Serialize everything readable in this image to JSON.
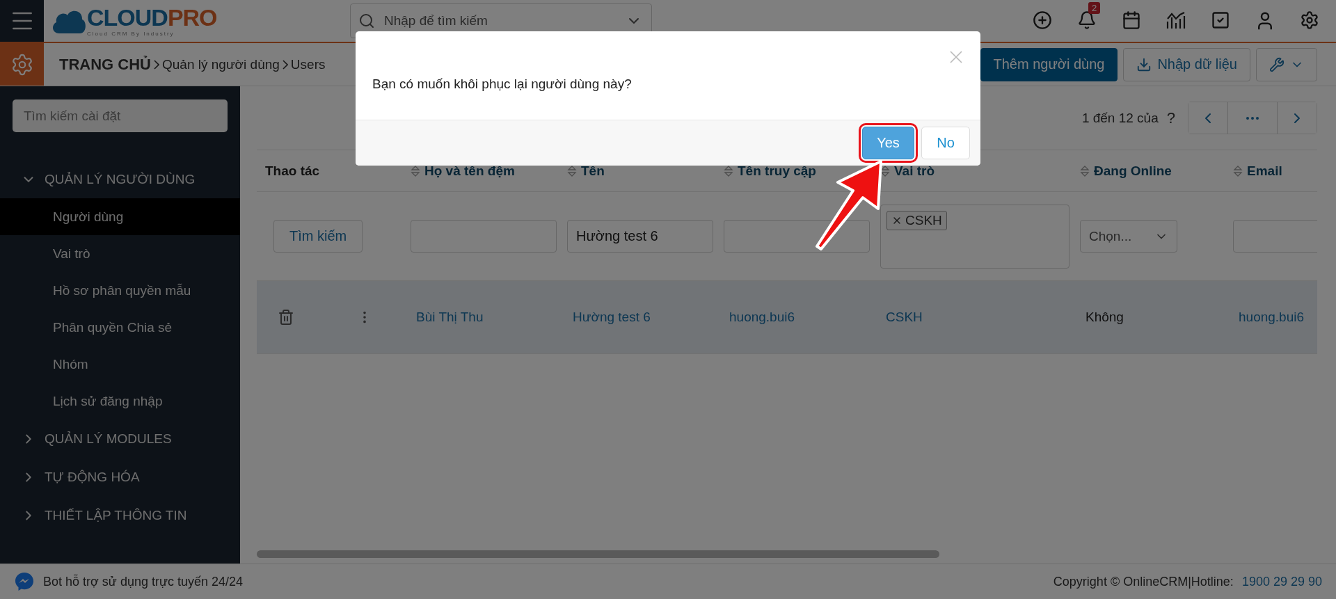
{
  "logo": {
    "name": "CLOUD",
    "accent": "PRO",
    "tagline": "Cloud CRM By Industry"
  },
  "search": {
    "placeholder": "Nhập để tìm kiếm"
  },
  "notification_badge": "2",
  "breadcrumb": [
    "TRANG CHỦ",
    "Quản lý người dùng",
    "Users"
  ],
  "actions": [
    {
      "label": "Thêm người dùng",
      "kind": "primary"
    },
    {
      "label": "Nhập dữ liệu",
      "kind": "import"
    },
    {
      "kind": "tools"
    }
  ],
  "sidebar": {
    "search_placeholder": "Tìm kiếm cài đặt",
    "groups": [
      {
        "label": "QUẢN LÝ NGƯỜI DÙNG",
        "expanded": true,
        "children": [
          {
            "label": "Người dùng",
            "selected": true
          },
          {
            "label": "Vai trò",
            "selected": false
          },
          {
            "label": "Hồ sơ phân quyền mẫu",
            "selected": false
          },
          {
            "label": "Phân quyền Chia sẻ",
            "selected": false
          },
          {
            "label": "Nhóm",
            "selected": false
          },
          {
            "label": "Lịch sử đăng nhập",
            "selected": false
          }
        ]
      },
      {
        "label": "QUẢN LÝ MODULES",
        "expanded": false
      },
      {
        "label": "TỰ ĐỘNG HÓA",
        "expanded": false
      },
      {
        "label": "THIẾT LẬP THÔNG TIN",
        "expanded": false
      }
    ]
  },
  "pager": {
    "summary": "1 đến 12 của",
    "total": "?"
  },
  "table": {
    "columns": [
      {
        "label": "Thao tác",
        "sortable": false
      },
      {
        "label": "Họ và tên đệm",
        "sortable": true
      },
      {
        "label": "Tên",
        "sortable": true
      },
      {
        "label": "Tên truy cập",
        "sortable": true
      },
      {
        "label": "Vai trò",
        "sortable": true
      },
      {
        "label": "Đang Online",
        "sortable": true
      },
      {
        "label": "Email",
        "sortable": true
      }
    ],
    "filters": [
      {
        "kind": "button",
        "label": "Tìm kiếm"
      },
      {
        "kind": "input"
      },
      {
        "kind": "input",
        "value": "Hường test 6"
      },
      {
        "kind": "input"
      },
      {
        "kind": "tags",
        "tags": [
          "CSKH"
        ]
      },
      {
        "kind": "select",
        "placeholder": "Chọn..."
      },
      {
        "kind": "input"
      }
    ],
    "rows": [
      {
        "highlighted": true,
        "cells": [
          {
            "kind": "actions"
          },
          {
            "kind": "link",
            "text": "Bùi Thị Thu"
          },
          {
            "kind": "link",
            "text": "Hường test 6"
          },
          {
            "kind": "link",
            "text": "huong.bui6"
          },
          {
            "kind": "link",
            "text": "CSKH"
          },
          {
            "kind": "text",
            "text": "Không"
          },
          {
            "kind": "link",
            "text": "huong.bui6"
          }
        ]
      }
    ]
  },
  "footer": {
    "bot_text": "Bot hỗ trợ sử dụng trực tuyến 24/24",
    "copyright": "Copyright © OnlineCRM|Hotline:",
    "hotline": "1900 29 29 90"
  },
  "dialog": {
    "message": "Bạn có muốn khôi phục lại người dùng này?",
    "buttons": [
      {
        "label": "Yes",
        "kind": "primary",
        "highlighted": true
      },
      {
        "label": "No",
        "kind": "default",
        "highlighted": false
      }
    ]
  }
}
